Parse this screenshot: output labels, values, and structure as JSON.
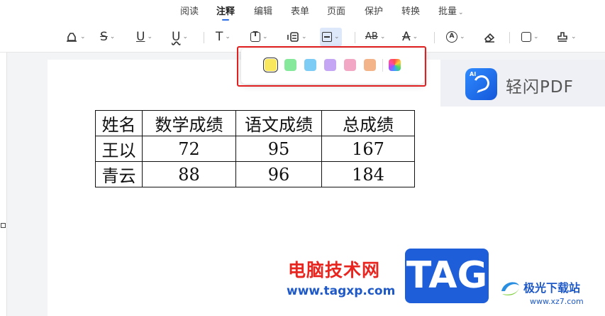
{
  "menu": {
    "items": [
      {
        "label": "阅读"
      },
      {
        "label": "注释",
        "active": true
      },
      {
        "label": "编辑"
      },
      {
        "label": "表单"
      },
      {
        "label": "页面"
      },
      {
        "label": "保护"
      },
      {
        "label": "转换"
      },
      {
        "label": "批量"
      }
    ]
  },
  "toolbar": {
    "tools": [
      {
        "name": "highlight-tool",
        "icon": "highlighter-icon"
      },
      {
        "name": "strikethrough-tool",
        "icon": "strikethrough-icon",
        "glyph": "S"
      },
      {
        "name": "underline-tool",
        "icon": "underline-icon",
        "glyph": "U"
      },
      {
        "name": "wavy-underline-tool",
        "icon": "wavy-underline-icon",
        "glyph": "U"
      },
      {
        "name": "text-tool",
        "icon": "text-icon",
        "glyph": "T"
      },
      {
        "name": "textbox-tool",
        "icon": "textbox-icon",
        "glyph": "T"
      },
      {
        "name": "callout-tool",
        "icon": "callout-icon"
      },
      {
        "name": "note-tool",
        "icon": "note-icon",
        "active": true
      },
      {
        "name": "replace-text-tool",
        "icon": "replace-text-icon",
        "glyph": "AB"
      },
      {
        "name": "insert-text-tool",
        "icon": "insert-text-icon",
        "glyph": "A"
      },
      {
        "name": "pen-tool",
        "icon": "pen-icon",
        "glyph": "A"
      },
      {
        "name": "eraser-tool",
        "icon": "eraser-icon"
      },
      {
        "name": "shape-tool",
        "icon": "rectangle-icon"
      },
      {
        "name": "stamp-tool",
        "icon": "stamp-icon"
      }
    ]
  },
  "palette": {
    "colors": [
      "#f9e75e",
      "#86e89a",
      "#7cccf6",
      "#c4a6f5",
      "#f2a8c4",
      "#f3b48a"
    ],
    "selected_index": 0
  },
  "brand": {
    "icon_text": "AI",
    "name": "轻闪PDF"
  },
  "table": {
    "headers": [
      "姓名",
      "数学成绩",
      "语文成绩",
      "总成绩"
    ],
    "rows": [
      [
        "王以",
        "72",
        "95",
        "167"
      ],
      [
        "青云",
        "88",
        "96",
        "184"
      ]
    ]
  },
  "watermark": {
    "site_name": "电脑技术网",
    "site_url": "www.tagxp.com",
    "tag": "TAG",
    "xz_name": "极光下载站",
    "xz_url": "www.xz7.com"
  },
  "colors": {
    "accent": "#2b6de6",
    "highlight_border": "#e02020"
  }
}
